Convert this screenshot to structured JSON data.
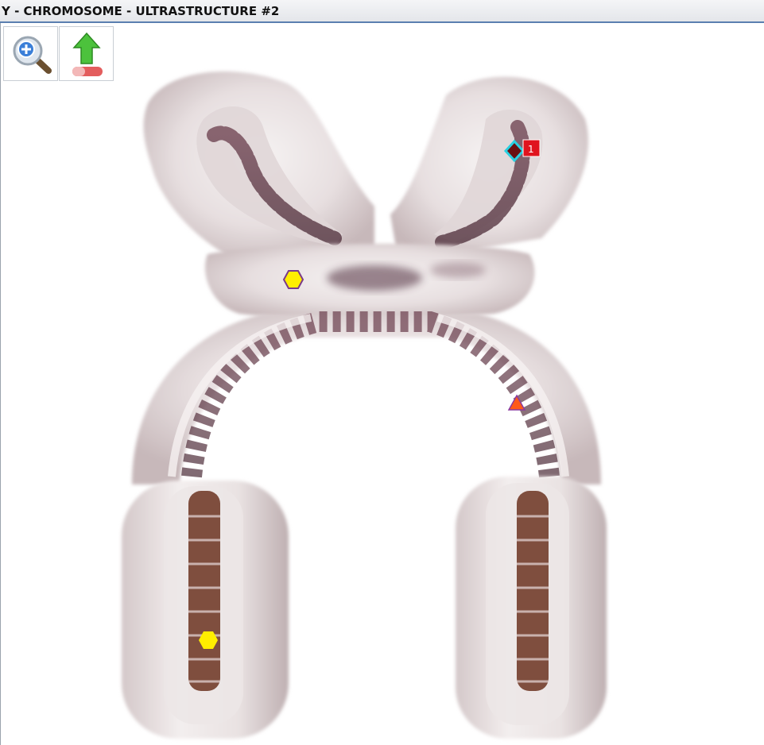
{
  "window": {
    "title": "Y - CHROMOSOME - ULTRASTRUCTURE #2"
  },
  "toolbar": {
    "zoom_in": {
      "icon": "zoom-in-magnifier-icon"
    },
    "export": {
      "icon": "upload-arrow-icon"
    }
  },
  "markers": {
    "diamond": {
      "label": "1",
      "icon": "diamond-marker-icon",
      "fill": "#6a1010",
      "stroke": "#2ad0e0",
      "badge_color": "#e0141e"
    },
    "centromere_hexagon": {
      "icon": "hexagon-marker-icon",
      "fill": "#ffee00",
      "stroke": "#7a3a8a"
    },
    "triangle": {
      "icon": "triangle-marker-icon",
      "fill": "#ff5a1a",
      "stroke": "#8a3aa0"
    },
    "lower_hexagon": {
      "icon": "hexagon-marker-icon",
      "fill": "#ffee00",
      "stroke": "#ffee00"
    }
  },
  "colors": {
    "chromatin_light": "#efeaea",
    "chromatin_shadow": "#c9bcbd",
    "band_dark": "#5a3340",
    "band_brown": "#6b3320",
    "title_border": "#5a7fb0"
  }
}
